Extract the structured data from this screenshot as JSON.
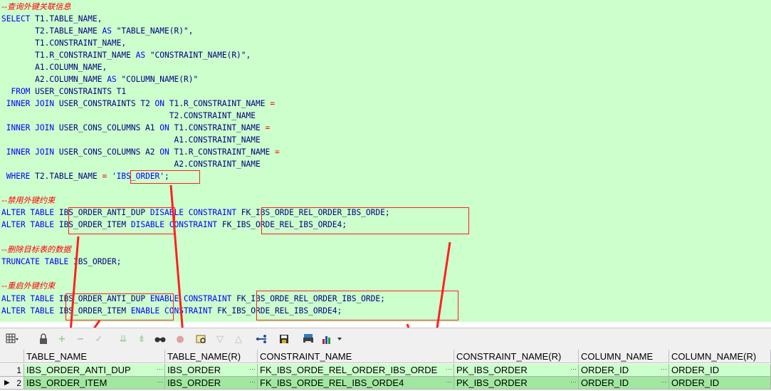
{
  "editor": {
    "lines": [
      [
        {
          "t": "--查询外键关联信息",
          "c": "cm"
        }
      ],
      [
        {
          "t": "SELECT ",
          "c": "kw"
        },
        {
          "t": "T1.TABLE_NAME,",
          "c": "id"
        }
      ],
      [
        {
          "t": "       T2.TABLE_NAME ",
          "c": "id"
        },
        {
          "t": "AS ",
          "c": "kw"
        },
        {
          "t": "\"TABLE_NAME(R)\",",
          "c": "id"
        }
      ],
      [
        {
          "t": "       T1.CONSTRAINT_NAME,",
          "c": "id"
        }
      ],
      [
        {
          "t": "       T1.R_CONSTRAINT_NAME ",
          "c": "id"
        },
        {
          "t": "AS ",
          "c": "kw"
        },
        {
          "t": "\"CONSTRAINT_NAME(R)\",",
          "c": "id"
        }
      ],
      [
        {
          "t": "       A1.COLUMN_NAME,",
          "c": "id"
        }
      ],
      [
        {
          "t": "       A2.COLUMN_NAME ",
          "c": "id"
        },
        {
          "t": "AS ",
          "c": "kw"
        },
        {
          "t": "\"COLUMN_NAME(R)\"",
          "c": "id"
        }
      ],
      [
        {
          "t": "  FROM ",
          "c": "kw"
        },
        {
          "t": "USER_CONSTRAINTS T1",
          "c": "id"
        }
      ],
      [
        {
          "t": " INNER JOIN ",
          "c": "kw"
        },
        {
          "t": "USER_CONSTRAINTS T2 ",
          "c": "id"
        },
        {
          "t": "ON ",
          "c": "kw"
        },
        {
          "t": "T1.R_CONSTRAINT_NAME ",
          "c": "id"
        },
        {
          "t": "=",
          "c": "sym"
        }
      ],
      [
        {
          "t": "                                   T2.CONSTRAINT_NAME",
          "c": "id"
        }
      ],
      [
        {
          "t": " INNER JOIN ",
          "c": "kw"
        },
        {
          "t": "USER_CONS_COLUMNS A1 ",
          "c": "id"
        },
        {
          "t": "ON ",
          "c": "kw"
        },
        {
          "t": "T1.CONSTRAINT_NAME ",
          "c": "id"
        },
        {
          "t": "=",
          "c": "sym"
        }
      ],
      [
        {
          "t": "                                    A1.CONSTRAINT_NAME",
          "c": "id"
        }
      ],
      [
        {
          "t": " INNER JOIN ",
          "c": "kw"
        },
        {
          "t": "USER_CONS_COLUMNS A2 ",
          "c": "id"
        },
        {
          "t": "ON ",
          "c": "kw"
        },
        {
          "t": "T1.R_CONSTRAINT_NAME ",
          "c": "id"
        },
        {
          "t": "=",
          "c": "sym"
        }
      ],
      [
        {
          "t": "                                    A2.CONSTRAINT_NAME",
          "c": "id"
        }
      ],
      [
        {
          "t": " WHERE ",
          "c": "kw"
        },
        {
          "t": "T2.TABLE_NAME ",
          "c": "id"
        },
        {
          "t": "= ",
          "c": "sym"
        },
        {
          "t": "'IBS_ORDER'",
          "c": "str"
        },
        {
          "t": ";",
          "c": "id"
        }
      ],
      [
        {
          "t": "",
          "c": "id"
        }
      ],
      [
        {
          "t": "--禁用外键约束",
          "c": "cm"
        }
      ],
      [
        {
          "t": "ALTER TABLE ",
          "c": "kw"
        },
        {
          "t": "IBS_ORDER_ANTI_DUP ",
          "c": "id"
        },
        {
          "t": "DISABLE CONSTRAINT ",
          "c": "kw"
        },
        {
          "t": "FK_IBS_ORDE_REL_ORDER_IBS_ORDE;",
          "c": "id"
        }
      ],
      [
        {
          "t": "ALTER TABLE ",
          "c": "kw"
        },
        {
          "t": "IBS_ORDER_ITEM ",
          "c": "id"
        },
        {
          "t": "DISABLE CONSTRAINT ",
          "c": "kw"
        },
        {
          "t": "FK_IBS_ORDE_REL_IBS_ORDE4;",
          "c": "id"
        }
      ],
      [
        {
          "t": "",
          "c": "id"
        }
      ],
      [
        {
          "t": "--删除目标表的数据",
          "c": "cm"
        }
      ],
      [
        {
          "t": "TRUNCATE TABLE ",
          "c": "kw"
        },
        {
          "t": "IBS_ORDER;",
          "c": "id"
        }
      ],
      [
        {
          "t": "",
          "c": "id"
        }
      ],
      [
        {
          "t": "--重启外键约束",
          "c": "cm"
        }
      ],
      [
        {
          "t": "ALTER TABLE ",
          "c": "kw"
        },
        {
          "t": "IBS_ORDER_ANTI_DUP ",
          "c": "id"
        },
        {
          "t": "ENABLE CONSTRAINT ",
          "c": "kw"
        },
        {
          "t": "FK_IBS_ORDE_REL_ORDER_IBS_ORDE;",
          "c": "id"
        }
      ],
      [
        {
          "t": "ALTER TABLE ",
          "c": "kw"
        },
        {
          "t": "IBS_ORDER_ITEM ",
          "c": "id"
        },
        {
          "t": "ENABLE CONSTRAINT ",
          "c": "kw"
        },
        {
          "t": "FK_IBS_ORDE_REL_IBS_ORDE4;",
          "c": "id"
        }
      ]
    ]
  },
  "toolbar": {
    "icons": [
      "grid-menu-icon",
      "lock-icon",
      "add-record-icon",
      "delete-record-icon",
      "post-icon",
      "fetch-next-icon",
      "fetch-last-icon",
      "find-icon",
      "clear-icon",
      "query-icon",
      "filter-down-icon",
      "filter-up-icon",
      "explain-icon",
      "save-icon",
      "print-icon",
      "chart-icon"
    ]
  },
  "grid": {
    "columns": [
      "TABLE_NAME",
      "TABLE_NAME(R)",
      "CONSTRAINT_NAME",
      "CONSTRAINT_NAME(R)",
      "COLUMN_NAME",
      "COLUMN_NAME(R)"
    ],
    "rows": [
      {
        "num": "1",
        "cells": [
          "IBS_ORDER_ANTI_DUP",
          "IBS_ORDER",
          "FK_IBS_ORDE_REL_ORDER_IBS_ORDE",
          "PK_IBS_ORDER",
          "ORDER_ID",
          "ORDER_ID"
        ]
      },
      {
        "num": "2",
        "cells": [
          "IBS_ORDER_ITEM",
          "IBS_ORDER",
          "FK_IBS_ORDE_REL_IBS_ORDE4",
          "PK_IBS_ORDER",
          "ORDER_ID",
          "ORDER_ID"
        ]
      }
    ],
    "current_marker": "▶"
  },
  "colors": {
    "editor_bg": "#ccffcc",
    "keyword": "#0000ff",
    "identifier": "#000080",
    "comment": "#ff0000",
    "annotation": "#ff2020"
  }
}
